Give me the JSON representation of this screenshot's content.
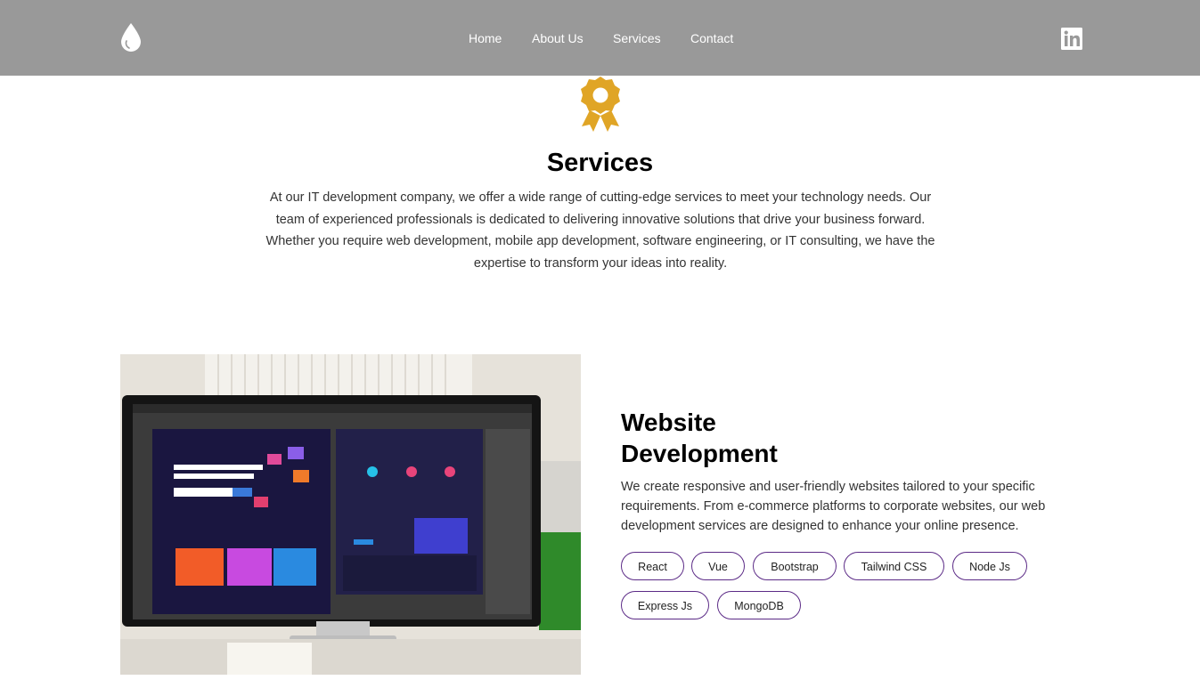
{
  "header": {
    "logo_icon": "water-drop-icon",
    "nav": [
      {
        "label": "Home"
      },
      {
        "label": "About Us"
      },
      {
        "label": "Services"
      },
      {
        "label": "Contact"
      }
    ],
    "social_icon": "linkedin-icon"
  },
  "intro": {
    "badge_icon": "award-badge-icon",
    "title": "Services",
    "text": "At our IT development company, we offer a wide range of cutting-edge services to meet your technology needs. Our team of experienced professionals is dedicated to delivering innovative solutions that drive your business forward. Whether you require web development, mobile app development, software engineering, or IT consulting, we have the expertise to transform your ideas into reality."
  },
  "service": {
    "image": "monitor-with-design-software-photo",
    "title": "Website Development",
    "description": "We create responsive and user-friendly websites tailored to your specific requirements. From e-commerce platforms to corporate websites, our web development services are designed to enhance your online presence.",
    "tags": [
      "React",
      "Vue",
      "Bootstrap",
      "Tailwind CSS",
      "Node Js",
      "Express Js",
      "MongoDB"
    ]
  },
  "colors": {
    "header_bg": "#999999",
    "accent_gold": "#e0a526",
    "tag_border": "#5b2a86"
  }
}
